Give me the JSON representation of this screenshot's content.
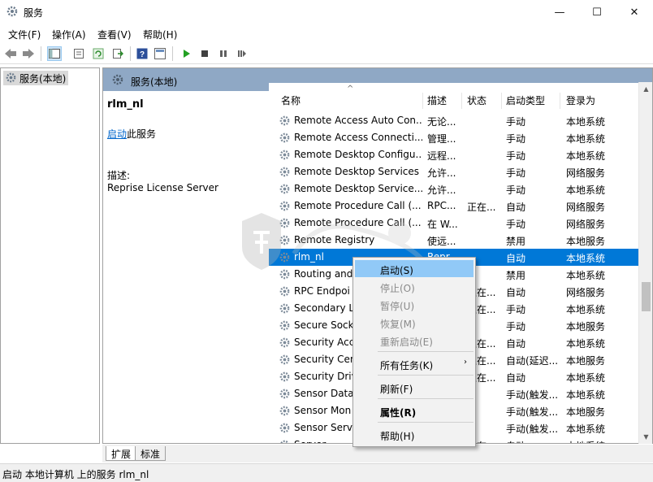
{
  "window": {
    "title": "服务",
    "minimize": "—",
    "maximize": "☐",
    "close": "✕"
  },
  "menubar": [
    "文件(F)",
    "操作(A)",
    "查看(V)",
    "帮助(H)"
  ],
  "tree": {
    "root_label": "服务(本地)"
  },
  "header": {
    "label": "服务(本地)"
  },
  "ext": {
    "service_name": "rlm_nl",
    "start_link": "启动",
    "start_suffix": "此服务",
    "desc_label": "描述:",
    "desc_value": "Reprise License Server"
  },
  "columns": {
    "name": "名称",
    "desc": "描述",
    "status": "状态",
    "startup": "启动类型",
    "logon": "登录为"
  },
  "rows": [
    {
      "name": "Remote Access Auto Con...",
      "desc": "无论...",
      "status": "",
      "startup": "手动",
      "logon": "本地系统"
    },
    {
      "name": "Remote Access Connecti...",
      "desc": "管理...",
      "status": "",
      "startup": "手动",
      "logon": "本地系统"
    },
    {
      "name": "Remote Desktop Configu...",
      "desc": "远程...",
      "status": "",
      "startup": "手动",
      "logon": "本地系统"
    },
    {
      "name": "Remote Desktop Services",
      "desc": "允许...",
      "status": "",
      "startup": "手动",
      "logon": "网络服务"
    },
    {
      "name": "Remote Desktop Service...",
      "desc": "允许...",
      "status": "",
      "startup": "手动",
      "logon": "本地系统"
    },
    {
      "name": "Remote Procedure Call (...",
      "desc": "RPC...",
      "status": "正在...",
      "startup": "自动",
      "logon": "网络服务"
    },
    {
      "name": "Remote Procedure Call (...",
      "desc": "在 W...",
      "status": "",
      "startup": "手动",
      "logon": "网络服务"
    },
    {
      "name": "Remote Registry",
      "desc": "使远...",
      "status": "",
      "startup": "禁用",
      "logon": "本地服务"
    },
    {
      "name": "rlm_nl",
      "desc": "Repr...",
      "status": "",
      "startup": "自动",
      "logon": "本地系统"
    },
    {
      "name": "Routing and",
      "desc": "",
      "status": "",
      "startup": "禁用",
      "logon": "本地系统"
    },
    {
      "name": "RPC Endpoi",
      "desc": "",
      "status": "正在...",
      "startup": "自动",
      "logon": "网络服务"
    },
    {
      "name": "Secondary L",
      "desc": "",
      "status": "正在...",
      "startup": "手动",
      "logon": "本地系统"
    },
    {
      "name": "Secure Sock",
      "desc": "",
      "status": "",
      "startup": "手动",
      "logon": "本地服务"
    },
    {
      "name": "Security Acc",
      "desc": "",
      "status": "正在...",
      "startup": "自动",
      "logon": "本地系统"
    },
    {
      "name": "Security Cen",
      "desc": "",
      "status": "正在...",
      "startup": "自动(延迟...",
      "logon": "本地服务"
    },
    {
      "name": "Security Driv",
      "desc": "",
      "status": "正在...",
      "startup": "自动",
      "logon": "本地系统"
    },
    {
      "name": "Sensor Data",
      "desc": "",
      "status": "",
      "startup": "手动(触发...",
      "logon": "本地系统"
    },
    {
      "name": "Sensor Mon",
      "desc": "",
      "status": "",
      "startup": "手动(触发...",
      "logon": "本地服务"
    },
    {
      "name": "Sensor Servi",
      "desc": "",
      "status": "",
      "startup": "手动(触发...",
      "logon": "本地系统"
    },
    {
      "name": "Server",
      "desc": "",
      "status": "正在...",
      "startup": "自动",
      "logon": "本地系统"
    }
  ],
  "selected_row": "rlm_nl",
  "context_menu": {
    "start": "启动(S)",
    "stop": "停止(O)",
    "pause": "暂停(U)",
    "resume": "恢复(M)",
    "restart": "重新启动(E)",
    "all_tasks": "所有任务(K)",
    "refresh": "刷新(F)",
    "properties": "属性(R)",
    "help": "帮助(H)"
  },
  "tabs": {
    "extended": "扩展",
    "standard": "标准"
  },
  "status": "启动 本地计算机 上的服务 rlm_nl",
  "colors": {
    "selection": "#0078d7",
    "header_band": "#8fa8c5",
    "menu_highlight": "#91c9f7"
  }
}
